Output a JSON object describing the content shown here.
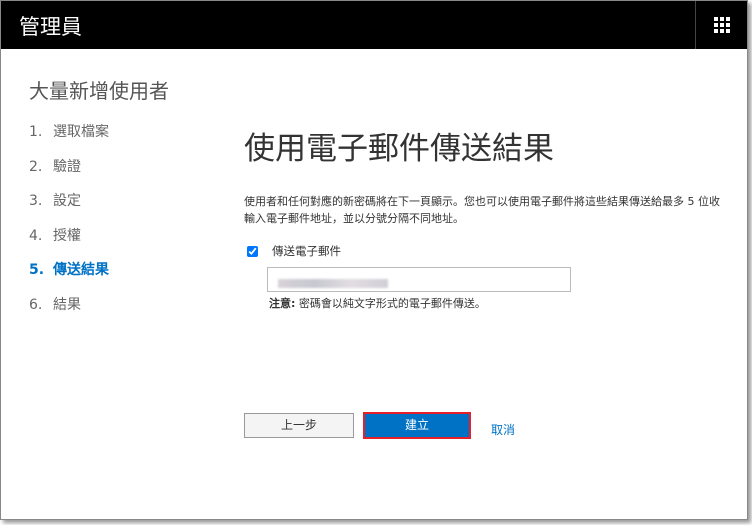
{
  "header": {
    "title": "管理員",
    "app_launcher_icon": "grid-icon"
  },
  "wizard": {
    "title": "大量新增使用者",
    "steps": [
      {
        "num": "1.",
        "label": "選取檔案"
      },
      {
        "num": "2.",
        "label": "驗證"
      },
      {
        "num": "3.",
        "label": "設定"
      },
      {
        "num": "4.",
        "label": "授權"
      },
      {
        "num": "5.",
        "label": "傳送結果",
        "active": true
      },
      {
        "num": "6.",
        "label": "結果"
      }
    ]
  },
  "main": {
    "title": "使用電子郵件傳送結果",
    "description_line1": "使用者和任何對應的新密碼將在下一頁顯示。您也可以使用電子郵件將這些結果傳送給最多 5 位收",
    "description_line2": "輸入電子郵件地址，並以分號分隔不同地址。",
    "send_email_label": "傳送電子郵件",
    "send_email_checked": true,
    "note_label": "注意:",
    "note_text": " 密碼會以純文字形式的電子郵件傳送。"
  },
  "buttons": {
    "back": "上一步",
    "create": "建立",
    "cancel": "取消"
  },
  "colors": {
    "accent": "#0072c6",
    "header": "#000000",
    "highlight": "#e8202a"
  }
}
